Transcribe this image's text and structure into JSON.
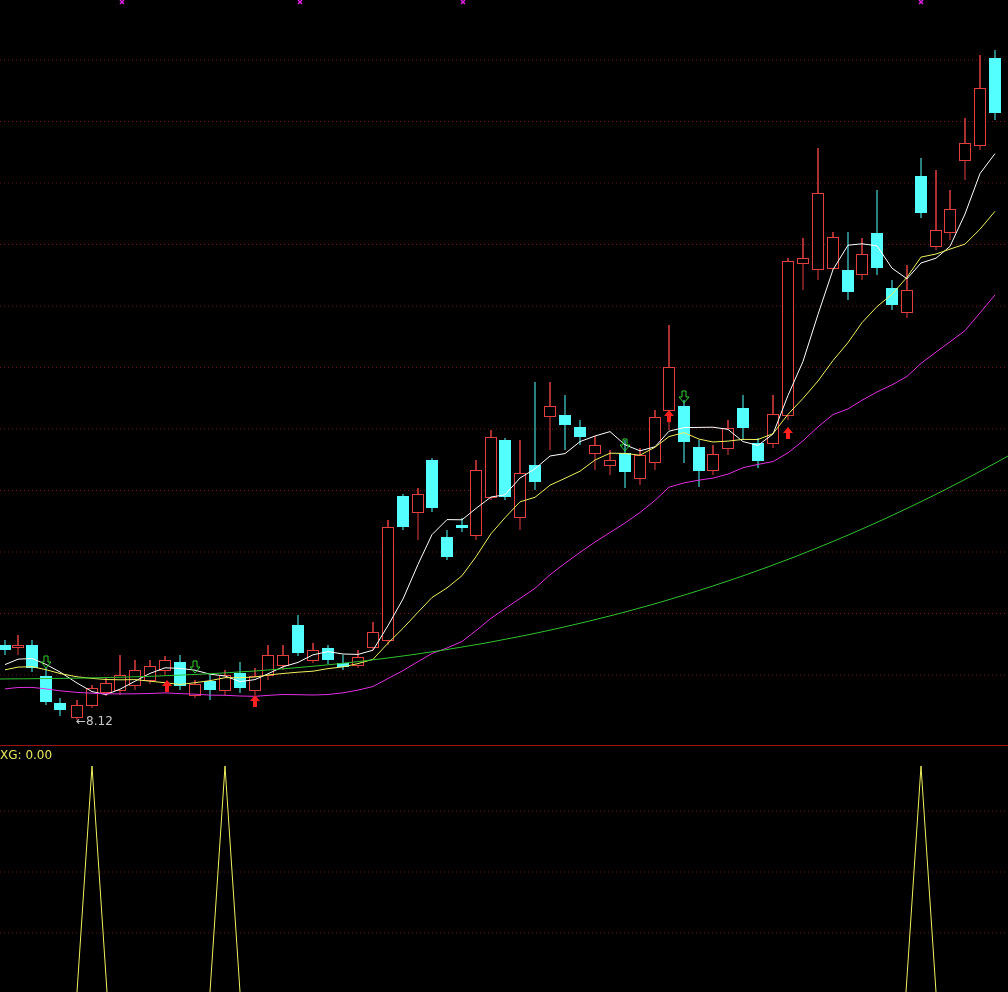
{
  "price_chart": {
    "low_marker": "←8.12"
  },
  "indicator_panel": {
    "label": "XG: 0.00"
  }
}
